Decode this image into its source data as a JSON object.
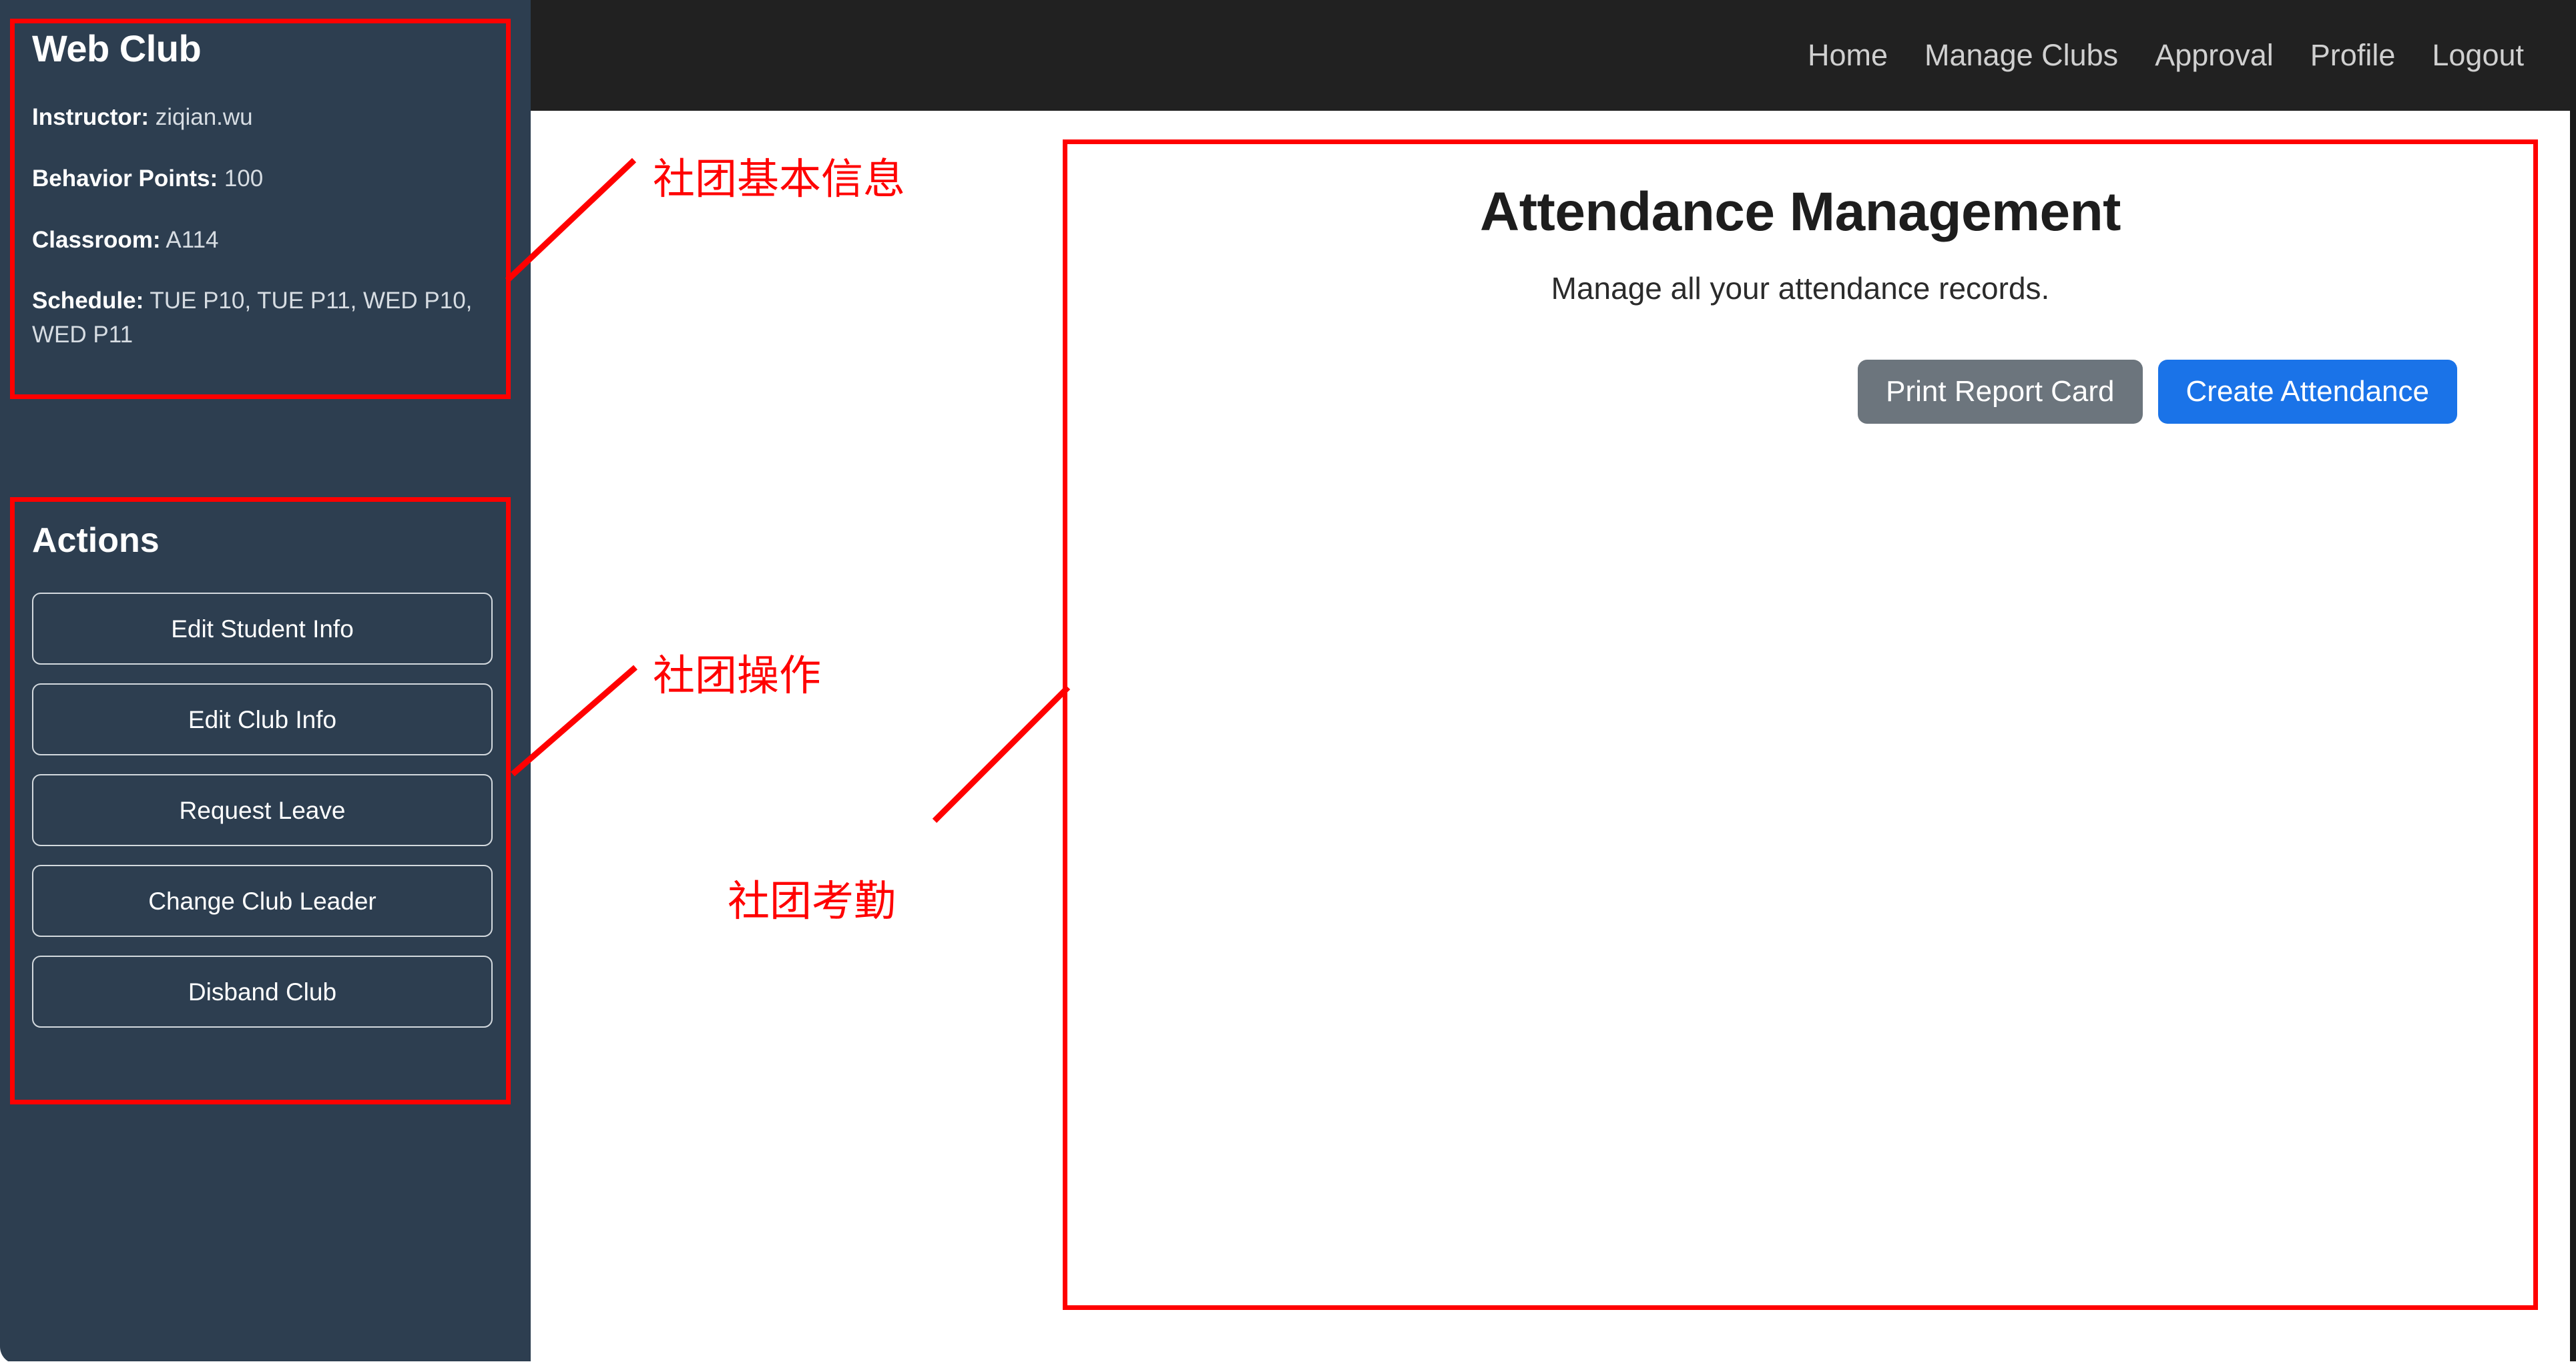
{
  "sidebar": {
    "club": {
      "name": "Web Club",
      "fields": [
        {
          "label": "Instructor:",
          "value": " ziqian.wu"
        },
        {
          "label": "Behavior Points:",
          "value": " 100"
        },
        {
          "label": "Classroom:",
          "value": " A114"
        },
        {
          "label": "Schedule:",
          "value": " TUE P10, TUE P11, WED P10, WED P11"
        }
      ]
    },
    "actions": {
      "title": "Actions",
      "buttons": [
        "Edit Student Info",
        "Edit Club Info",
        "Request Leave",
        "Change Club Leader",
        "Disband Club"
      ]
    }
  },
  "topnav": {
    "items": [
      "Home",
      "Manage Clubs",
      "Approval",
      "Profile",
      "Logout"
    ]
  },
  "main": {
    "title": "Attendance Management",
    "subtitle": "Manage all your attendance records.",
    "buttons": {
      "print_report_card": "Print Report Card",
      "create_attendance": "Create Attendance"
    }
  },
  "annotations": {
    "color": "#ff0000",
    "labels": [
      {
        "text": "社团基本信息"
      },
      {
        "text": "社团操作"
      },
      {
        "text": "社团考勤"
      }
    ]
  },
  "colors": {
    "sidebar_bg": "#2d3e50",
    "navbar_bg": "#212121",
    "primary_button": "#1a73e8",
    "secondary_button": "#6c757d",
    "annotation_red": "#ff0000"
  }
}
